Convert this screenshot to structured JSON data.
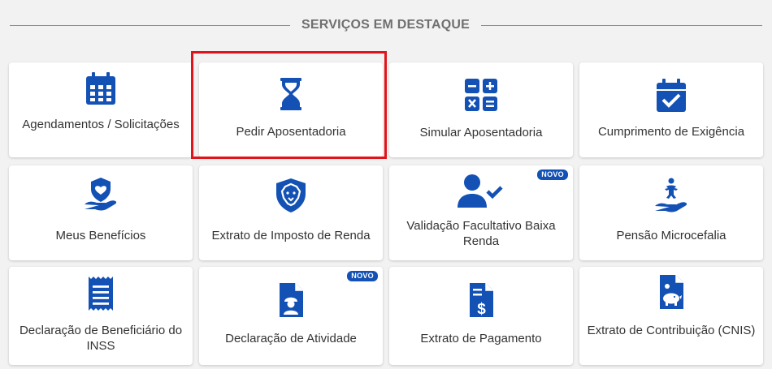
{
  "section": {
    "title": "SERVIÇOS EM DESTAQUE"
  },
  "colors": {
    "primary": "#1351b4",
    "highlight": "#e0151b",
    "text": "#333333",
    "background": "#f2f2f2"
  },
  "cards": [
    {
      "label": "Agendamentos / Solicitações",
      "icon": "calendar-grid-icon"
    },
    {
      "label": "Pedir Aposentadoria",
      "icon": "hourglass-icon",
      "highlighted": true
    },
    {
      "label": "Simular Aposentadoria",
      "icon": "calculator-icon"
    },
    {
      "label": "Cumprimento de Exigência",
      "icon": "calendar-check-icon"
    },
    {
      "label": "Meus Benefícios",
      "icon": "hand-heart-shield-icon"
    },
    {
      "label": "Extrato de Imposto de Renda",
      "icon": "lion-shield-icon"
    },
    {
      "label": "Validação Facultativo Baixa Renda",
      "icon": "user-check-icon",
      "badge": "NOVO"
    },
    {
      "label": "Pensão Microcefalia",
      "icon": "hand-baby-icon"
    },
    {
      "label": "Declaração de Beneficiário do INSS",
      "icon": "receipt-icon"
    },
    {
      "label": "Declaração de Atividade",
      "icon": "document-worker-icon",
      "badge": "NOVO"
    },
    {
      "label": "Extrato de Pagamento",
      "icon": "document-dollar-icon"
    },
    {
      "label": "Extrato de Contribuição (CNIS)",
      "icon": "document-piggy-bank-icon"
    }
  ]
}
